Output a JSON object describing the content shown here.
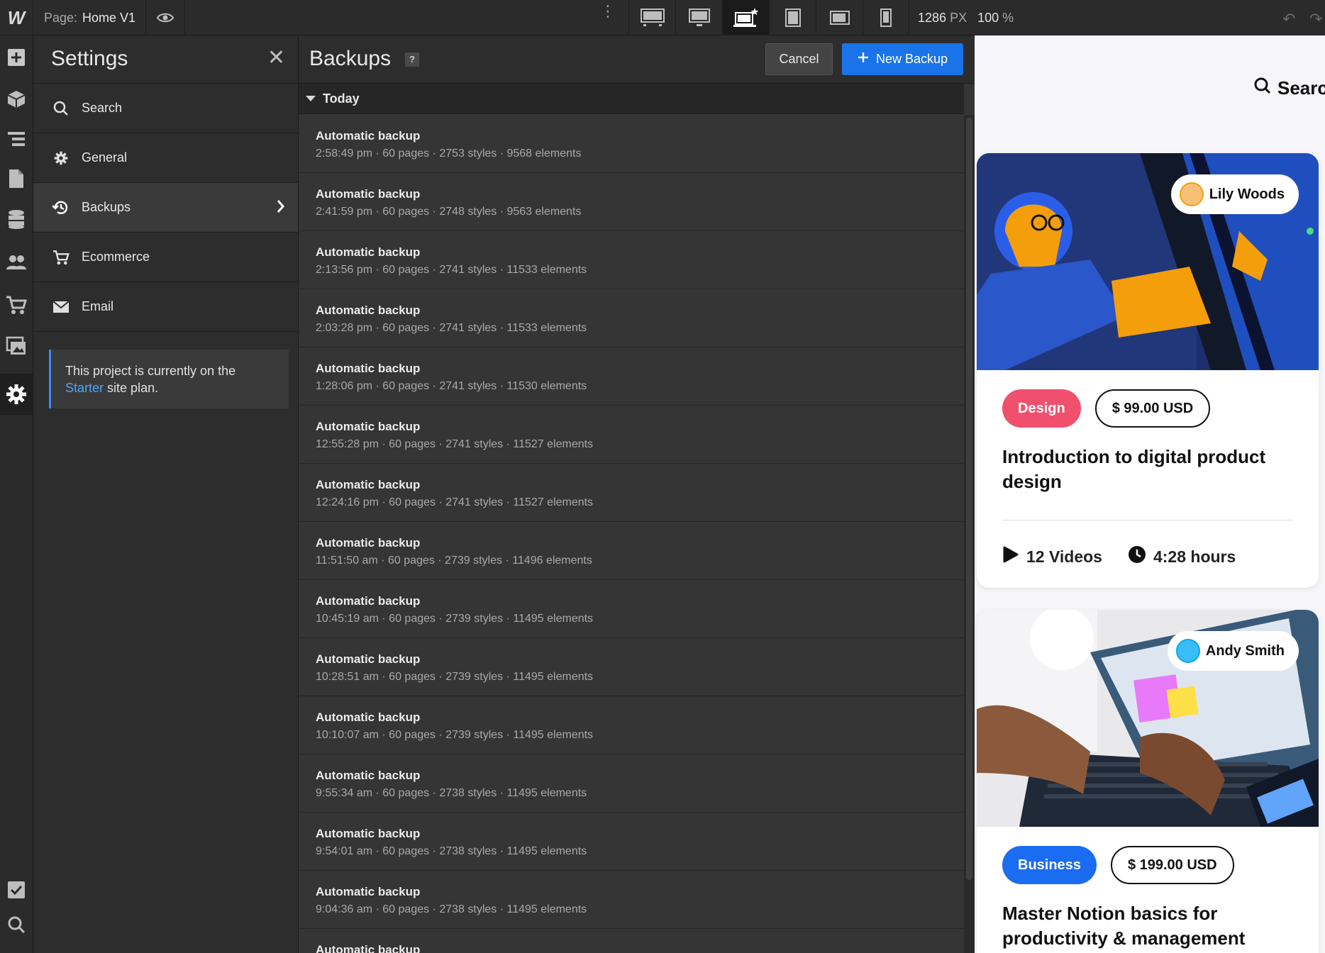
{
  "topbar": {
    "logo": "W",
    "page_label": "Page:",
    "page_name": "Home V1",
    "width_value": "1286",
    "width_unit": "PX",
    "zoom_value": "100",
    "zoom_unit": "%"
  },
  "settings": {
    "title": "Settings",
    "items": [
      {
        "label": "Search",
        "icon": "search-icon"
      },
      {
        "label": "General",
        "icon": "gear-icon"
      },
      {
        "label": "Backups",
        "icon": "history-icon"
      },
      {
        "label": "Ecommerce",
        "icon": "cart-icon"
      },
      {
        "label": "Email",
        "icon": "mail-icon"
      }
    ],
    "plan_text_before": "This project is currently on the",
    "plan_link": "Starter",
    "plan_text_after": "site plan."
  },
  "backups": {
    "title": "Backups",
    "help": "?",
    "cancel_label": "Cancel",
    "new_label": "New Backup",
    "group_label": "Today",
    "rows": [
      {
        "title": "Automatic backup",
        "meta": "2:58:49 pm · 60 pages · 2753 styles · 9568 elements"
      },
      {
        "title": "Automatic backup",
        "meta": "2:41:59 pm · 60 pages · 2748 styles · 9563 elements"
      },
      {
        "title": "Automatic backup",
        "meta": "2:13:56 pm · 60 pages · 2741 styles · 11533 elements"
      },
      {
        "title": "Automatic backup",
        "meta": "2:03:28 pm · 60 pages · 2741 styles · 11533 elements"
      },
      {
        "title": "Automatic backup",
        "meta": "1:28:06 pm · 60 pages · 2741 styles · 11530 elements"
      },
      {
        "title": "Automatic backup",
        "meta": "12:55:28 pm · 60 pages · 2741 styles · 11527 elements"
      },
      {
        "title": "Automatic backup",
        "meta": "12:24:16 pm · 60 pages · 2741 styles · 11527 elements"
      },
      {
        "title": "Automatic backup",
        "meta": "11:51:50 am · 60 pages · 2739 styles · 11496 elements"
      },
      {
        "title": "Automatic backup",
        "meta": "10:45:19 am · 60 pages · 2739 styles · 11495 elements"
      },
      {
        "title": "Automatic backup",
        "meta": "10:28:51 am · 60 pages · 2739 styles · 11495 elements"
      },
      {
        "title": "Automatic backup",
        "meta": "10:10:07 am · 60 pages · 2739 styles · 11495 elements"
      },
      {
        "title": "Automatic backup",
        "meta": "9:55:34 am · 60 pages · 2738 styles · 11495 elements"
      },
      {
        "title": "Automatic backup",
        "meta": "9:54:01 am · 60 pages · 2738 styles · 11495 elements"
      },
      {
        "title": "Automatic backup",
        "meta": "9:04:36 am · 60 pages · 2738 styles · 11495 elements"
      },
      {
        "title": "Automatic backup",
        "meta": ""
      }
    ]
  },
  "preview": {
    "search_label": "Searc",
    "cards": [
      {
        "author": "Lily Woods",
        "category": "Design",
        "category_color": "#f0506e",
        "price": "$ 99.00 USD",
        "title": "Introduction to digital product design",
        "videos": "12 Videos",
        "duration": "4:28 hours"
      },
      {
        "author": "Andy Smith",
        "category": "Business",
        "category_color": "#1a6cf0",
        "price": "$ 199.00 USD",
        "title": "Master Notion basics for productivity & management"
      }
    ]
  }
}
